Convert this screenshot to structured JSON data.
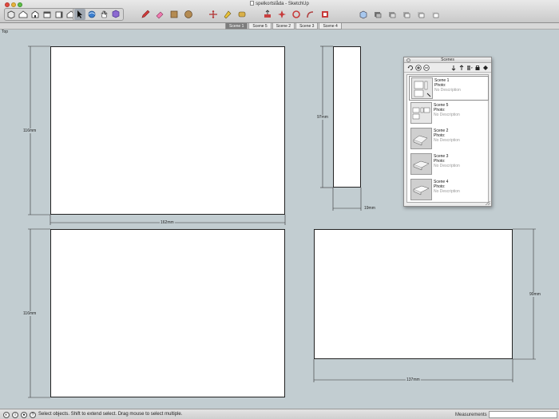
{
  "window": {
    "title": "spelkortslåda - SketchUp"
  },
  "toolbar": {
    "left_icons": [
      "new-icon",
      "open-icon",
      "save-icon",
      "cut-icon",
      "copy-icon",
      "paste-icon"
    ],
    "tools": [
      "select-icon",
      "orbit-icon",
      "pan-icon",
      "zoom-icon"
    ]
  },
  "scene_tabs": [
    "Scene 1",
    "Scene 5",
    "Scene 2",
    "Scene 3",
    "Scene 4"
  ],
  "active_tab": "Scene 1",
  "view_label": "Top",
  "dimensions": {
    "top_left_height": "116mm",
    "top_left_width": "162mm",
    "top_right_height": "97mm",
    "top_right_width": "19mm",
    "bottom_left_height": "116mm",
    "bottom_right_height": "90mm",
    "bottom_right_width": "137mm"
  },
  "scenes_panel": {
    "title": "Scenes",
    "items": [
      {
        "name": "Scene 1",
        "photo": "Photo:",
        "description": "No Description"
      },
      {
        "name": "Scene 5",
        "photo": "Photo:",
        "description": "No Description"
      },
      {
        "name": "Scene 2",
        "photo": "Photo:",
        "description": "No Description"
      },
      {
        "name": "Scene 3",
        "photo": "Photo:",
        "description": "No Description"
      },
      {
        "name": "Scene 4",
        "photo": "Photo:",
        "description": "No Description"
      }
    ]
  },
  "status": {
    "message": "Select objects. Shift to extend select. Drag mouse to select multiple.",
    "measurements_label": "Measurements",
    "measurements_value": ""
  },
  "colors": {
    "canvas": "#c2cdd1",
    "active_tab": "#7d7d7d"
  }
}
